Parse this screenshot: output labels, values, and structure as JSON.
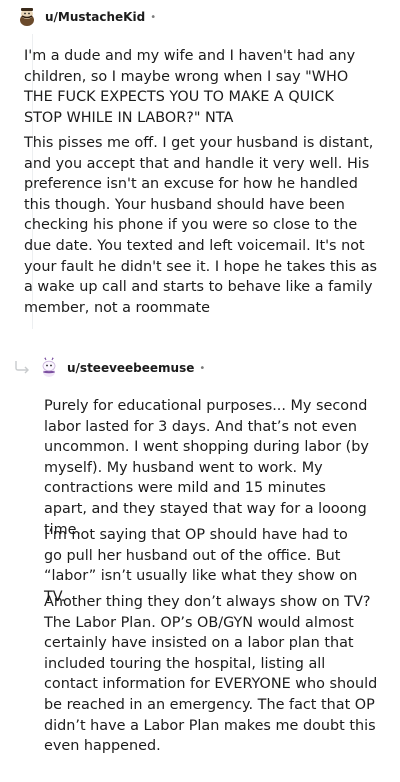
{
  "comment1": {
    "username": "u/MustacheKid",
    "separator": "•",
    "paragraphs": [
      "I'm a dude and my wife and I haven't had any children, so I maybe wrong when I say \"WHO THE FUCK EXPECTS YOU TO MAKE A QUICK STOP WHILE IN LABOR?\" NTA",
      "This pisses me off. I get your husband is distant, and you accept that and handle it very well. His preference isn't an excuse for how he handled this though. Your husband should have been checking his phone if you were so close to the due date. You texted and left voicemail. It's not your fault he didn't see it. I hope he takes this as a wake up call and starts to behave like a family member, not a roommate"
    ]
  },
  "comment2": {
    "username": "u/steeveebeemuse",
    "separator": "•",
    "paragraphs": [
      "Purely for educational purposes... My second labor lasted for 3 days. And that’s not even uncommon. I went shopping during labor (by myself). My husband went to work. My contractions were mild and 15 minutes apart, and they stayed that way for a looong time.",
      "I’m not saying that OP should have had to go pull her husband out of the office. But “labor” isn’t usually like what they show on TV.",
      "Another thing they don’t always show on TV? The Labor Plan. OP’s OB/GYN would almost certainly have insisted on a labor plan that included touring the hospital, listing all contact information for EVERYONE who should be reached in an emergency. The fact that OP didn’t have a Labor Plan makes me doubt this even happened."
    ]
  },
  "icons": {
    "avatar1": "snoo-avatar-mustache-icon",
    "avatar2": "snoo-avatar-bee-icon",
    "reply": "reply-arrow-icon"
  },
  "colors": {
    "text": "#1c1c1c",
    "meta": "#7c7c7c",
    "thread_line": "#edeff1"
  }
}
